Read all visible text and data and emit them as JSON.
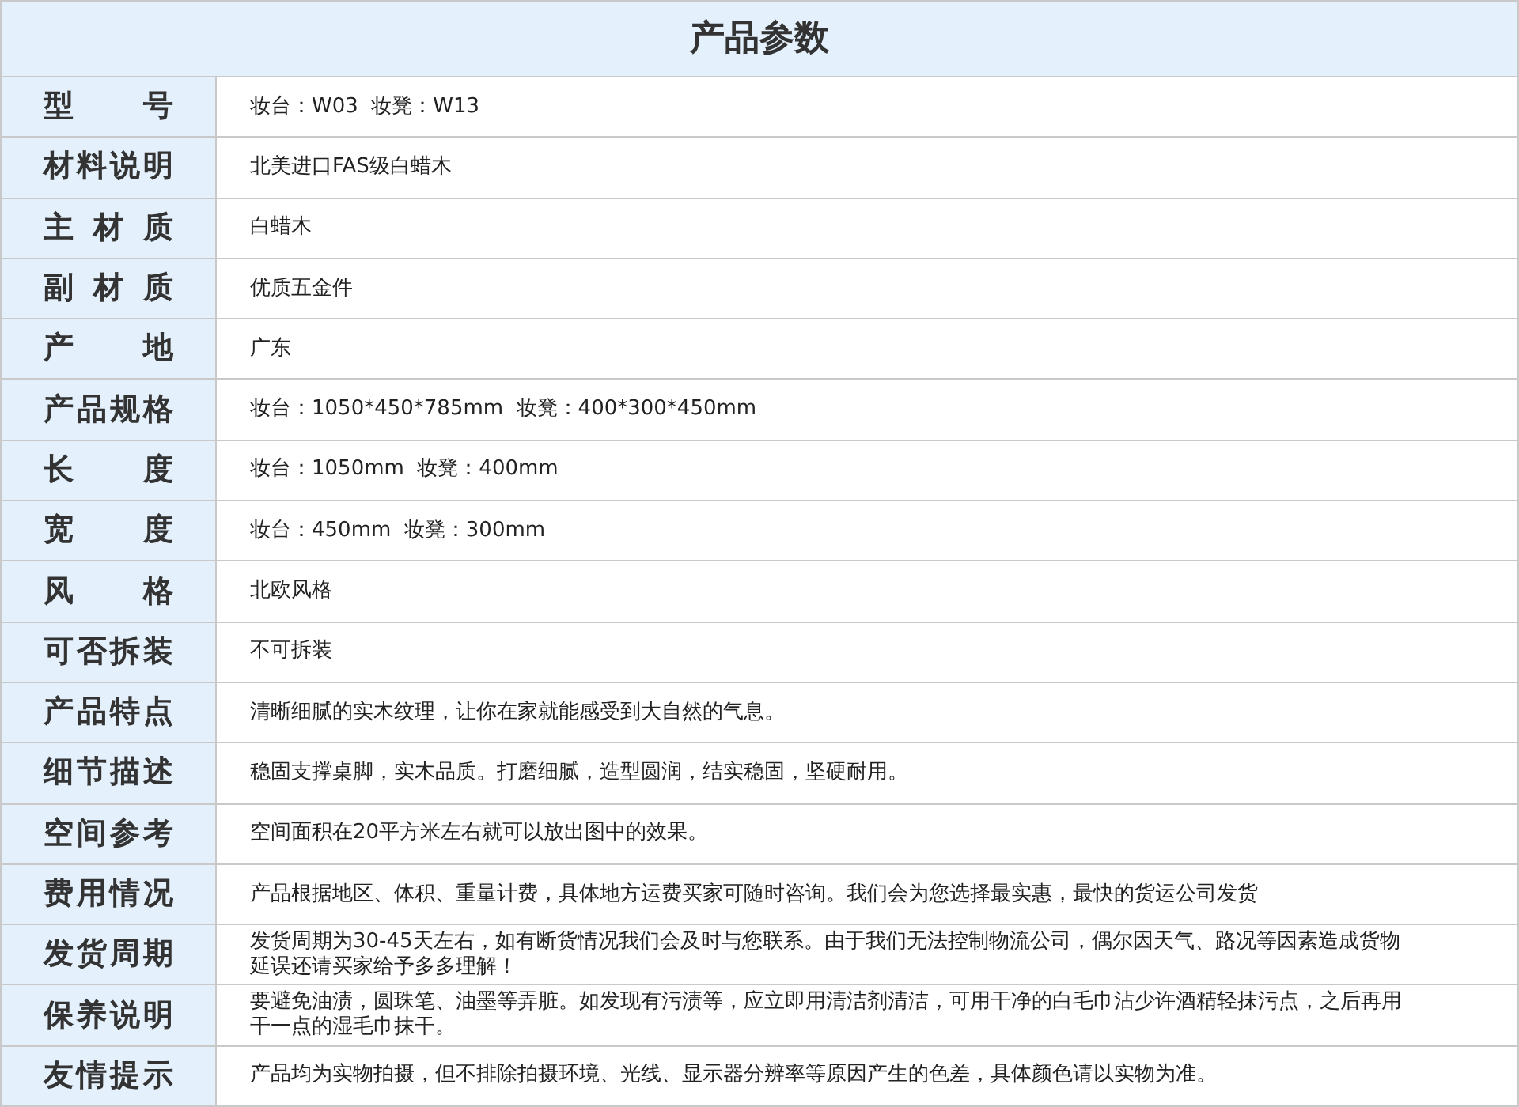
{
  "title": "产品参数",
  "rows": [
    {
      "label": "型 号",
      "value": "妆台：W03  妆凳：W13"
    },
    {
      "label": "材料说明",
      "value": "北美进口FAS级白蜡木"
    },
    {
      "label": "主 材 质",
      "value": "白蜡木"
    },
    {
      "label": "副 材 质",
      "value": "优质五金件"
    },
    {
      "label": "产 地",
      "value": "广东"
    },
    {
      "label": "产品规格",
      "value": "妆台：1050*450*785mm  妆凳：400*300*450mm"
    },
    {
      "label": "长 度",
      "value": "妆台：1050mm  妆凳：400mm"
    },
    {
      "label": "宽 度",
      "value": "妆台：450mm  妆凳：300mm"
    },
    {
      "label": "风 格",
      "value": "北欧风格"
    },
    {
      "label": "可否拆装",
      "value": "不可拆装"
    },
    {
      "label": "产品特点",
      "value": "清晰细腻的实木纹理，让你在家就能感受到大自然的气息。"
    },
    {
      "label": "细节描述",
      "value": "稳固支撑桌脚，实木品质。打磨细腻，造型圆润，结实稳固，坚硬耐用。"
    },
    {
      "label": "空间参考",
      "value": "空间面积在20平方米左右就可以放出图中的效果。"
    },
    {
      "label": "费用情况",
      "value": "产品根据地区、体积、重量计费，具体地方运费买家可随时咨询。我们会为您选择最实惠，最快的货运公司发货"
    },
    {
      "label": "发货周期",
      "value": "发货周期为30-45天左右，如有断货情况我们会及时与您联系。由于我们无法控制物流公司，偶尔因天气、路况等因素造成货物延误还请买家给予多多理解！"
    },
    {
      "label": "保养说明",
      "value": "要避免油渍，圆珠笔、油墨等弄脏。如发现有污渍等，应立即用清洁剂清洁，可用干净的白毛巾沾少许酒精轻抹污点，之后再用干一点的湿毛巾抹干。"
    },
    {
      "label": "友情提示",
      "value": "产品均为实物拍摄，但不排除拍摄环境、光线、显示器分辨率等原因产生的色差，具体颜色请以实物为准。"
    }
  ]
}
